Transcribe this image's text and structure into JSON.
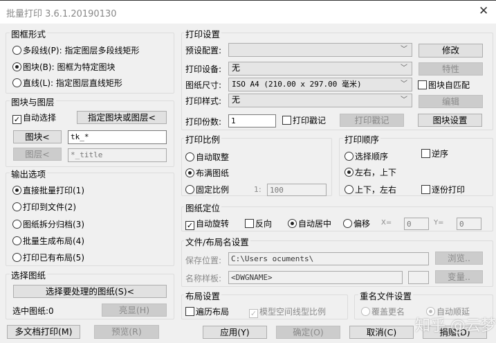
{
  "window": {
    "title": "批量打印 3.6.1.20190130",
    "close_icon": "✕"
  },
  "frame_type": {
    "label": "图框形式",
    "options": [
      "多段线(P): 指定图层多段线矩形",
      "图块(B): 图框为特定图块",
      "直线(L): 指定图层直线矩形"
    ],
    "selected": 1
  },
  "block_layer": {
    "label": "图块与图层",
    "auto_select": "自动选择",
    "auto_select_checked": true,
    "specify_button": "指定图块或图层<",
    "block_button": "图块<",
    "block_value": "tk_*",
    "layer_button": "图层<",
    "layer_value": "*_title"
  },
  "output": {
    "label": "输出选项",
    "options": [
      "直接批量打印(1)",
      "打印到文件(2)",
      "图纸拆分归档(3)",
      "批量生成布局(4)",
      "打印已有布局(5)"
    ],
    "selected": 0
  },
  "select_drawings": {
    "label": "选择图纸",
    "select_button": "选择要处理的图纸(S)<",
    "selected_count_label": "选中图纸:0",
    "highlight_button": "亮显(H)"
  },
  "print_settings": {
    "label": "打印设置",
    "preset_label": "预设配置:",
    "preset_value": "",
    "modify_button": "修改",
    "device_label": "打印设备:",
    "device_value": "无",
    "properties_button": "特性",
    "paper_label": "图纸尺寸:",
    "paper_value": "ISO A4 (210.00 x 297.00 毫米)",
    "block_auto_match": "图块自匹配",
    "style_label": "打印样式:",
    "style_value": "无",
    "edit_button": "编辑",
    "copies_label": "打印份数:",
    "copies_value": "1",
    "stamp_checkbox": "打印戳记",
    "stamp_button": "打印戳记",
    "block_settings_button": "图块设置"
  },
  "scale": {
    "label": "打印比例",
    "options": [
      "自动取整",
      "布满图纸",
      "固定比例"
    ],
    "selected": 1,
    "ratio_prefix": "1:",
    "ratio_value": "100"
  },
  "order": {
    "label": "打印顺序",
    "options": [
      "选择顺序",
      "左右，上下",
      "上下，左右"
    ],
    "selected": 1,
    "reverse": "逆序",
    "collate": "逐份打印"
  },
  "positioning": {
    "label": "图纸定位",
    "auto_rotate": "自动旋转",
    "reverse": "反向",
    "auto_center": "自动居中",
    "offset": "偏移",
    "x_label": "X=",
    "x_value": "0",
    "y_label": "Y=",
    "y_value": "0"
  },
  "file_naming": {
    "label": "文件/布局名设置",
    "save_label": "保存位置:",
    "save_value": "C:\\Users          ocuments\\",
    "browse_button": "浏览..",
    "template_label": "名称样板:",
    "template_value": "<DWGNAME>",
    "variable_button": "变量.."
  },
  "layout": {
    "label": "布局设置",
    "traverse": "遍历布局",
    "model_linetype": "模型空间线型比例"
  },
  "rename": {
    "label": "重名文件设置",
    "overwrite": "覆盖更名",
    "auto_increment": "自动顺延"
  },
  "footer": {
    "multi_doc": "多文档打印(M)",
    "preview": "预览(R)",
    "apply": "应用(Y)",
    "ok": "确定(O)",
    "cancel": "取消(C)",
    "donate": "捐赠(D)"
  },
  "watermark": "知乎 @云梦泽"
}
